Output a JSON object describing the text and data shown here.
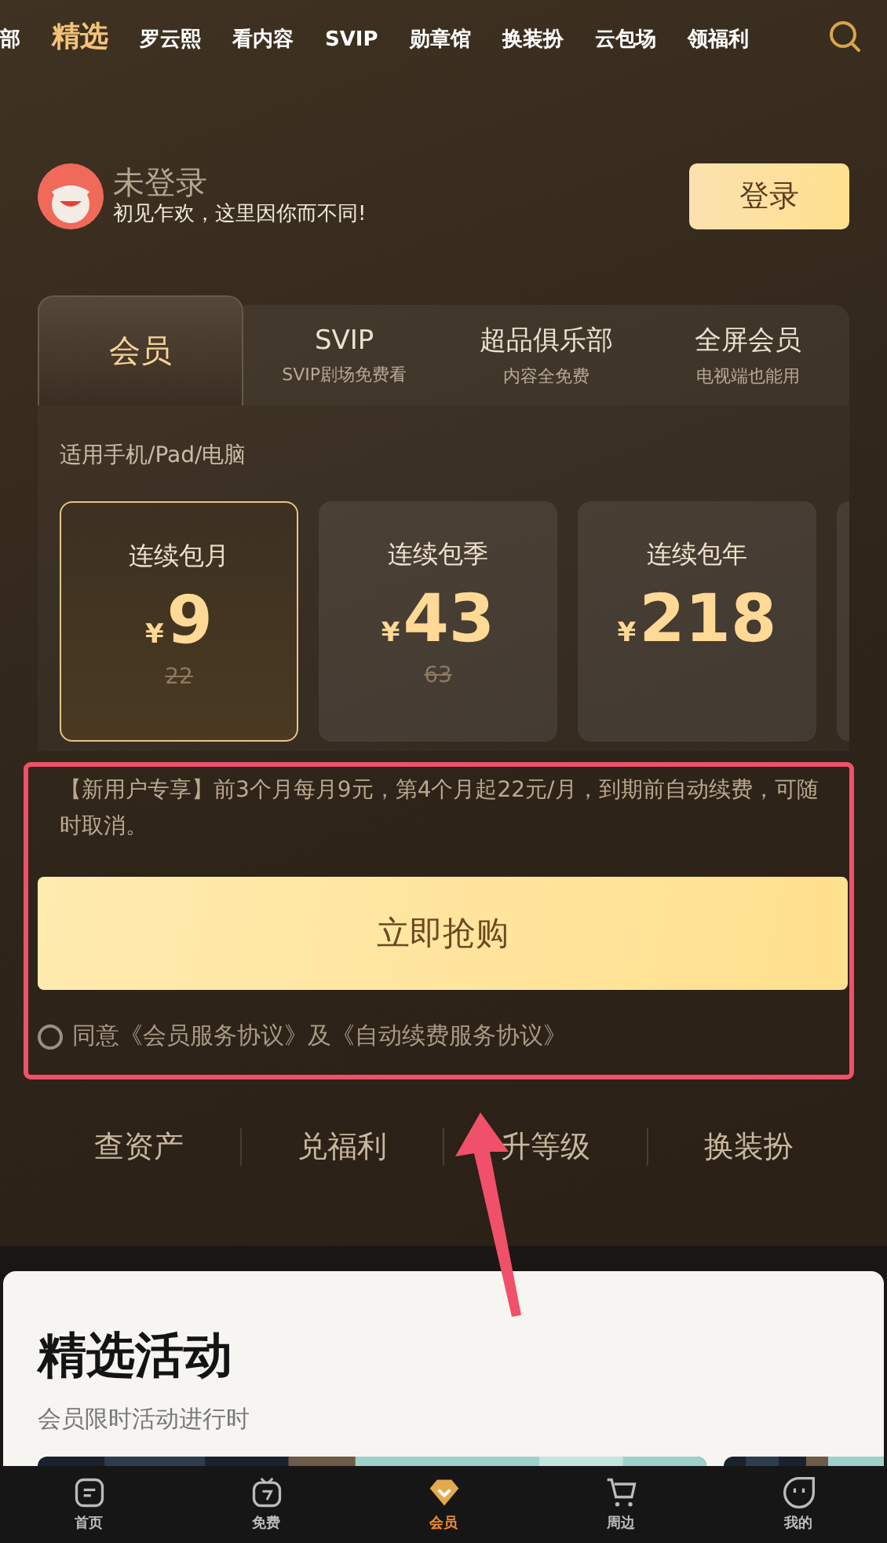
{
  "top_nav": {
    "items": [
      {
        "label": "部",
        "selected": false
      },
      {
        "label": "精选",
        "selected": true
      },
      {
        "label": "罗云熙",
        "selected": false
      },
      {
        "label": "看内容",
        "selected": false
      },
      {
        "label": "SVIP",
        "selected": false
      },
      {
        "label": "勋章馆",
        "selected": false
      },
      {
        "label": "换装扮",
        "selected": false
      },
      {
        "label": "云包场",
        "selected": false
      },
      {
        "label": "领福利",
        "selected": false
      }
    ]
  },
  "user": {
    "name": "未登录",
    "greeting": "初见乍欢，这里因你而不同!",
    "login_button": "登录"
  },
  "membership_tabs": [
    {
      "title": "会员",
      "selected": true
    },
    {
      "title": "SVIP",
      "subtitle": "SVIP剧场免费看",
      "selected": false
    },
    {
      "title": "超品俱乐部",
      "subtitle": "内容全免费",
      "selected": false
    },
    {
      "title": "全屏会员",
      "subtitle": "电视端也能用",
      "selected": false
    }
  ],
  "platforms": "适用手机/Pad/电脑",
  "plans": [
    {
      "name": "连续包月",
      "currency": "¥",
      "price": "9",
      "original_price": "22",
      "selected": true
    },
    {
      "name": "连续包季",
      "currency": "¥",
      "price": "43",
      "original_price": "63",
      "selected": false
    },
    {
      "name": "连续包年",
      "currency": "¥",
      "price": "218",
      "selected": false
    }
  ],
  "promo_text": "【新用户专享】前3个月每月9元，第4个月起22元/月，到期前自动续费，可随时取消。",
  "buy_button": "立即抢购",
  "agreement": {
    "checked": false,
    "text": "同意《会员服务协议》及《自动续费服务协议》"
  },
  "quick_links": [
    "查资产",
    "兑福利",
    "升等级",
    "换装扮"
  ],
  "activities": {
    "title": "精选活动",
    "subtitle": "会员限时活动进行时"
  },
  "bottom_nav": [
    {
      "label": "首页",
      "kind": "home",
      "selected": false
    },
    {
      "label": "免费",
      "kind": "tv",
      "selected": false
    },
    {
      "label": "会员",
      "kind": "vip",
      "selected": true
    },
    {
      "label": "周边",
      "kind": "cart",
      "selected": false
    },
    {
      "label": "我的",
      "kind": "face",
      "selected": false
    }
  ]
}
